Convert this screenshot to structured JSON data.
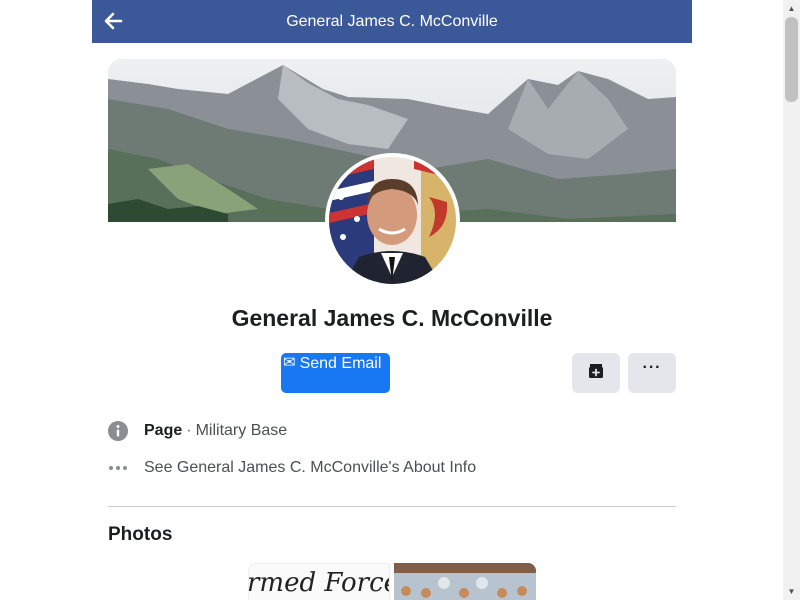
{
  "header": {
    "title": "General James C. McConville",
    "back_icon": "arrow-left-icon"
  },
  "profile": {
    "name": "General James C. McConville",
    "cover_icon": "mountain-landscape",
    "avatar_icon": "profile-photo"
  },
  "actions": {
    "send_email_label": "Send Email",
    "send_email_icon": "✉",
    "save_icon": "save-icon",
    "more_icon": "···"
  },
  "about": {
    "page_type_label": "Page",
    "separator": "·",
    "category": "Military Base",
    "about_link": "See General James C. McConville's About Info"
  },
  "photos": {
    "title": "Photos",
    "first_photo_text": "rmed ForcesL"
  },
  "colors": {
    "header_bg": "#3b5998",
    "primary_button": "#1877f2",
    "secondary_button": "#e4e6eb",
    "text_primary": "#1c1e21",
    "text_secondary": "#4b4f56"
  }
}
